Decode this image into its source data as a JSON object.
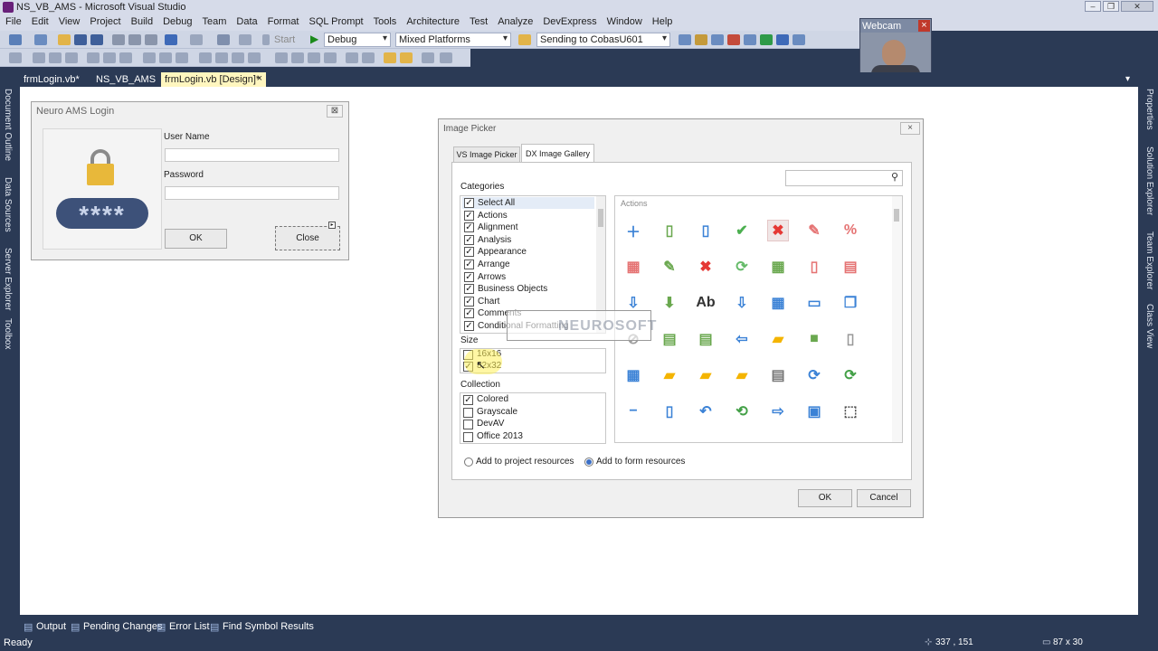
{
  "app": {
    "title": "NS_VB_AMS - Microsoft Visual Studio"
  },
  "menu": [
    "File",
    "Edit",
    "View",
    "Project",
    "Build",
    "Debug",
    "Team",
    "Data",
    "Format",
    "SQL Prompt",
    "Tools",
    "Architecture",
    "Test",
    "Analyze",
    "DevExpress",
    "Window",
    "Help"
  ],
  "toolbar": {
    "start_label": "Start",
    "config": "Debug",
    "platform": "Mixed Platforms",
    "startup": "Sending to CobasU601"
  },
  "webcam": {
    "label": "Webcam",
    "close": "×"
  },
  "doctabs": [
    {
      "label": "frmLogin.vb*"
    },
    {
      "label": "NS_VB_AMS"
    },
    {
      "label": "frmLogin.vb [Design]*",
      "close": "×"
    }
  ],
  "left_strip": [
    "Document Outline",
    "Data Sources",
    "Server Explorer",
    "Toolbox"
  ],
  "right_strip": [
    "Properties",
    "Solution Explorer",
    "Team Explorer",
    "Class View"
  ],
  "login": {
    "title": "Neuro AMS Login",
    "password_mask": "****",
    "username_label": "User Name",
    "password_label": "Password",
    "ok": "OK",
    "close": "Close",
    "close_x": "⊠"
  },
  "picker": {
    "title": "Image Picker",
    "close_x": "×",
    "tabs": [
      "VS Image Picker",
      "DX Image Gallery"
    ],
    "categories_label": "Categories",
    "categories": [
      "Select All",
      "Actions",
      "Alignment",
      "Analysis",
      "Appearance",
      "Arrange",
      "Arrows",
      "Business Objects",
      "Chart",
      "Comments",
      "Conditional Formatting"
    ],
    "size_label": "Size",
    "sizes": [
      {
        "label": "16x16",
        "checked": false
      },
      {
        "label": "32x32",
        "checked": true
      }
    ],
    "collection_label": "Collection",
    "collections": [
      {
        "label": "Colored",
        "checked": true
      },
      {
        "label": "Grayscale",
        "checked": false
      },
      {
        "label": "DevAV",
        "checked": false
      },
      {
        "label": "Office 2013",
        "checked": false
      }
    ],
    "gallery_header": "Actions",
    "watermark": "NEUROSOFT",
    "radio_project": "Add to project resources",
    "radio_form": "Add to form resources",
    "ok": "OK",
    "cancel": "Cancel"
  },
  "bottom_tabs": [
    "Output",
    "Pending Changes",
    "Error List",
    "Find Symbol Results"
  ],
  "status": {
    "ready": "Ready",
    "position": "337 , 151",
    "size": "87 x 30"
  },
  "colors": {
    "chrome": "#2b3a55",
    "menubar": "#d6dbe9",
    "active_tab": "#fff6bf"
  }
}
